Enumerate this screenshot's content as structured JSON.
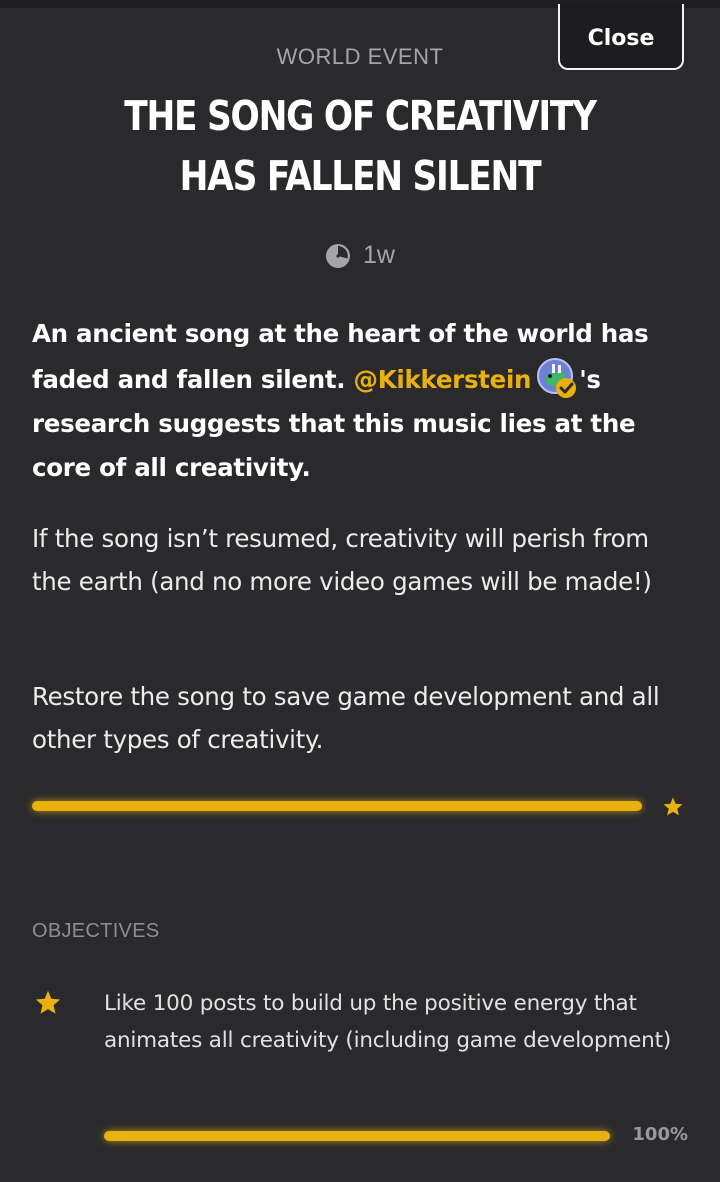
{
  "header": {
    "close_label": "Close",
    "eyebrow": "WORLD EVENT",
    "title": "THE SONG OF CREATIVITY HAS FALLEN SILENT",
    "time_ago": "1w"
  },
  "description": {
    "intro_before": "An ancient song at the heart of the world has faded and fallen silent. ",
    "mention": "@Kikkerstein",
    "intro_after": "'s research suggests that this music lies at the core of all creativity.",
    "paragraph_2": "If the song isn’t resumed, creativity will perish from the earth (and no more video games will be made!)",
    "paragraph_3": "Restore the song to save game development and all other types of creativity."
  },
  "event_progress": {
    "fraction": 1.0,
    "icon": "star-icon"
  },
  "objectives": {
    "header": "OBJECTIVES",
    "items": [
      {
        "icon": "star-icon",
        "text": "Like 100 posts to build up the positive energy that animates all creativity (including game development)",
        "progress_fraction": 1.0,
        "progress_label": "100%"
      }
    ]
  },
  "colors": {
    "background": "#2a2a2d",
    "accent": "#e8b10e",
    "muted_text": "#a6a6a8",
    "track": "#3a3a3d"
  }
}
